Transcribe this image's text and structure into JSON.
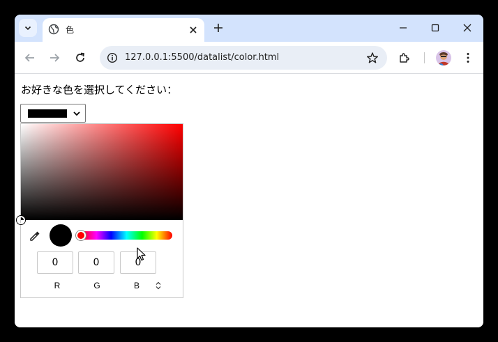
{
  "browser": {
    "tab": {
      "title": "色"
    },
    "address": {
      "url": "127.0.0.1:5500/datalist/color.html"
    }
  },
  "page": {
    "prompt": "お好きな色を選択してください：",
    "select": {
      "value_color": "#000000"
    }
  },
  "picker": {
    "hue_color": "#ff0000",
    "preview_color": "#000000",
    "rgb": {
      "r_value": "0",
      "g_value": "0",
      "b_value": "0",
      "r_label": "R",
      "g_label": "G",
      "b_label": "B"
    }
  },
  "icons": {
    "tab_search": "chevron-down-icon",
    "favicon": "globe-icon",
    "tab_close": "close-icon",
    "new_tab": "plus-icon",
    "back": "arrow-left-icon",
    "forward": "arrow-right-icon",
    "reload": "reload-icon",
    "site_info": "info-icon",
    "bookmark": "star-icon",
    "extensions": "puzzle-icon",
    "menu": "kebab-menu-icon",
    "eyedropper": "eyedropper-icon"
  }
}
